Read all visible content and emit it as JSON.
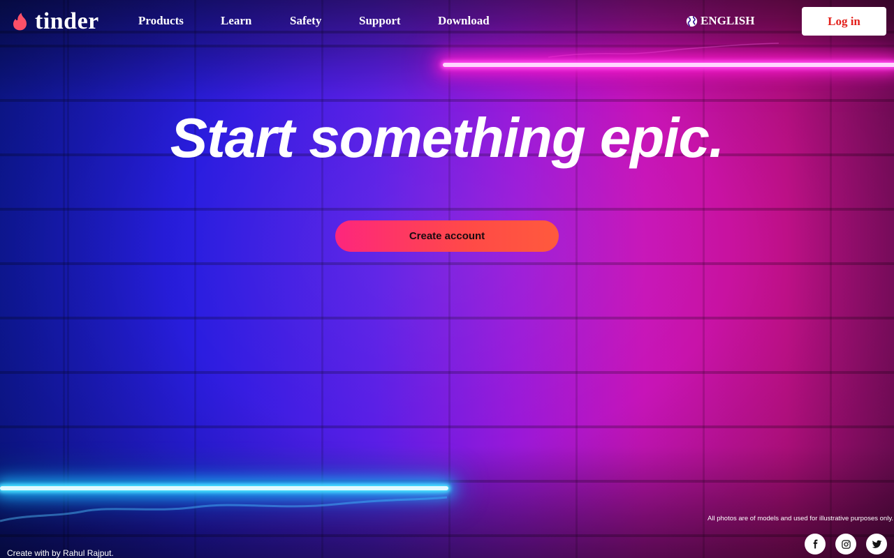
{
  "brand": {
    "name": "tinder",
    "accent": "#fd5068"
  },
  "nav": {
    "items": [
      {
        "label": "Products"
      },
      {
        "label": "Learn"
      },
      {
        "label": "Safety"
      },
      {
        "label": "Support"
      },
      {
        "label": "Download"
      }
    ],
    "language": {
      "label": "ENGLISH",
      "icon": "globe-icon"
    },
    "login_label": "Log in",
    "login_color": "#e3211c"
  },
  "hero": {
    "title": "Start something epic.",
    "cta_label": "Create account",
    "cta_gradient": [
      "#fd267d",
      "#ff5a3d"
    ]
  },
  "footer": {
    "disclaimer": "All photos are of models and used for illustrative purposes only.",
    "credit": "Create with  by Rahul Rajput.",
    "social": [
      {
        "icon": "facebook-icon"
      },
      {
        "icon": "instagram-icon"
      },
      {
        "icon": "twitter-icon"
      }
    ]
  },
  "background": {
    "neon_top_color": "#ff1fd2",
    "neon_bottom_color": "#1fb8ff"
  }
}
